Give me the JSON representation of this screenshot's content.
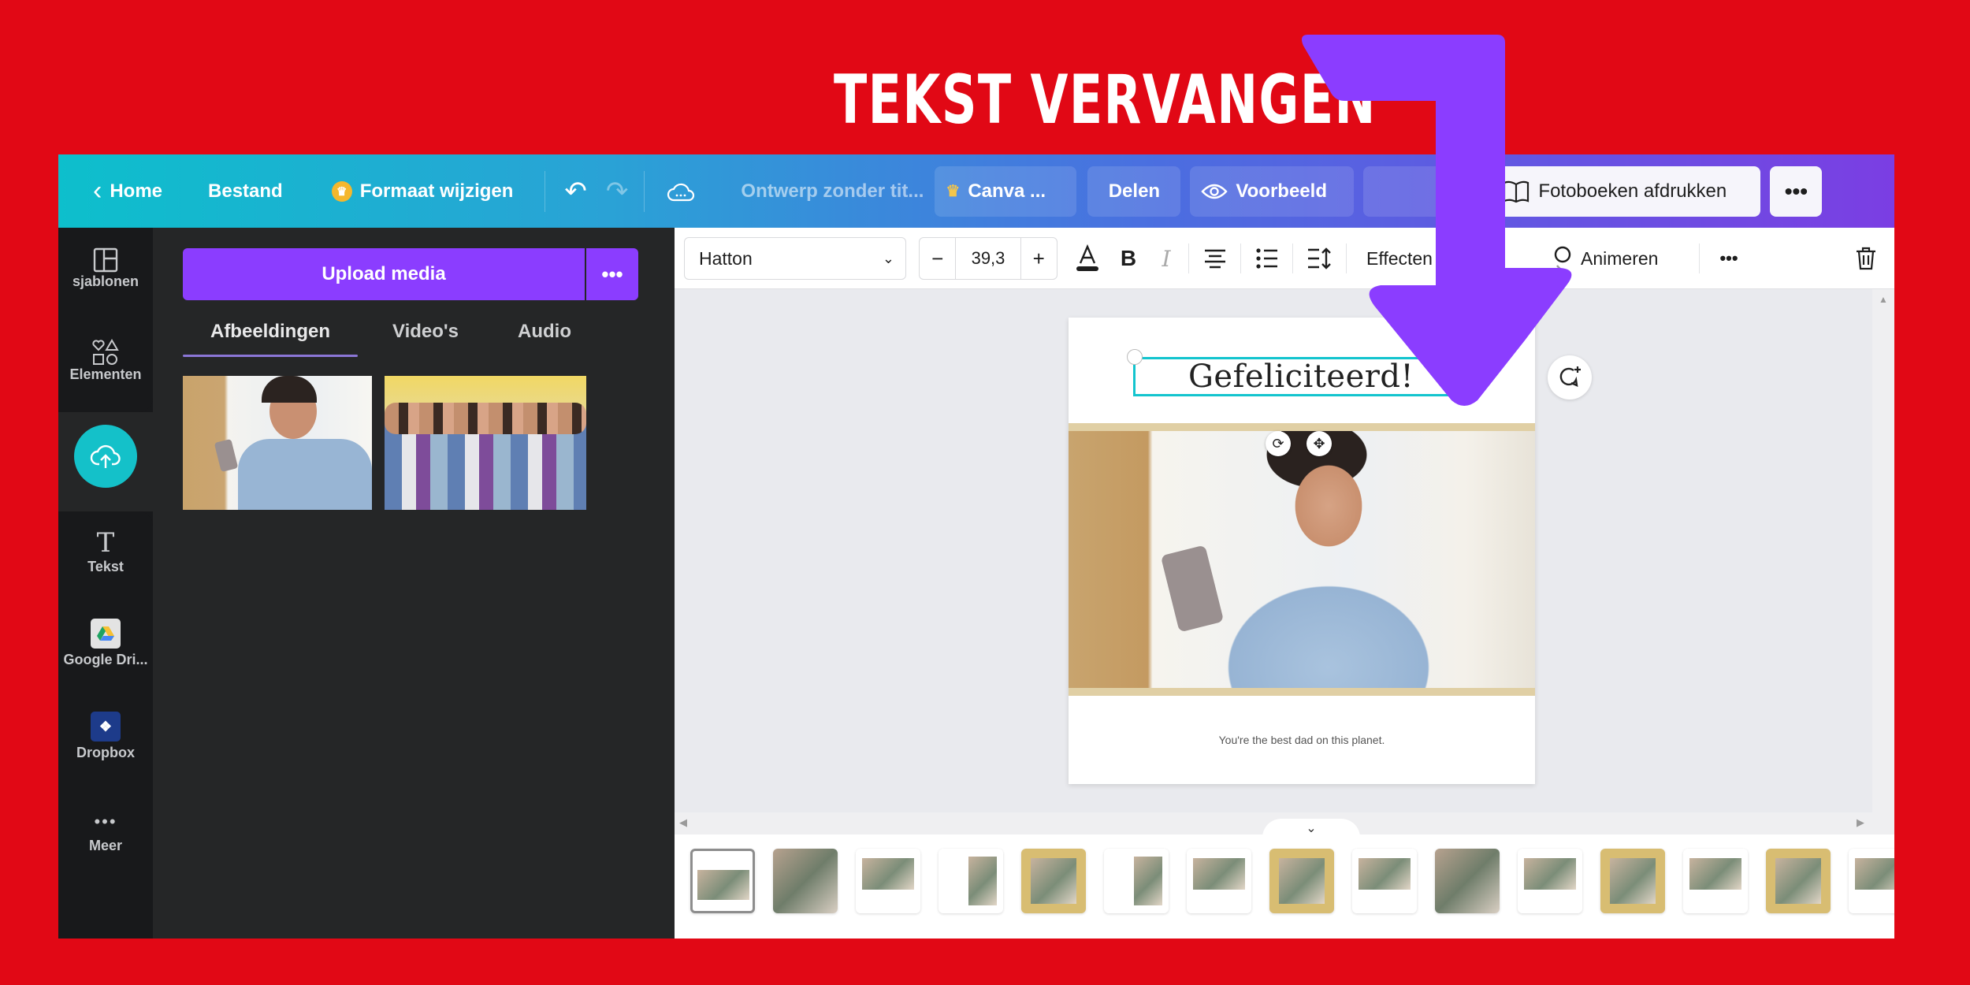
{
  "banner": {
    "title": "TEKST VERVANGEN"
  },
  "colors": {
    "background": "#e10815",
    "accent_purple": "#8b3dff",
    "teal": "#14c1c9",
    "arrow": "#8b3dff"
  },
  "topbar": {
    "home_label": "Home",
    "file_label": "Bestand",
    "resize_label": "Formaat wijzigen",
    "title_placeholder": "Ontwerp zonder tit...",
    "pro_label": "Canva ...",
    "share_label": "Delen",
    "preview_label": "Voorbeeld",
    "print_label": "Fotoboeken afdrukken",
    "more_label": "•••",
    "icons": {
      "back": "chevron-left-icon",
      "crown": "crown-icon",
      "undo": "undo-icon",
      "redo": "redo-icon",
      "cloud": "cloud-sync-icon",
      "eye": "eye-icon",
      "download": "download-icon",
      "book": "book-icon"
    }
  },
  "rail": {
    "items": [
      {
        "label": "sjablonen",
        "icon": "templates-icon"
      },
      {
        "label": "Elementen",
        "icon": "elements-icon"
      },
      {
        "label": "",
        "icon": "upload-cloud-icon"
      },
      {
        "label": "Tekst",
        "icon": "text-icon"
      },
      {
        "label": "Google Dri...",
        "icon": "google-drive-icon"
      },
      {
        "label": "Dropbox",
        "icon": "dropbox-icon"
      },
      {
        "label": "Meer",
        "icon": "more-icon"
      }
    ]
  },
  "panel": {
    "upload_label": "Upload media",
    "upload_more": "•••",
    "tabs": [
      {
        "label": "Afbeeldingen",
        "active": true
      },
      {
        "label": "Video's"
      },
      {
        "label": "Audio"
      }
    ],
    "images": [
      "man-with-phone",
      "group-of-teens"
    ]
  },
  "toolbar": {
    "font": "Hatton",
    "font_size": "39,3",
    "minus": "−",
    "plus": "+",
    "effects_label": "Effecten",
    "animate_label": "Animeren",
    "more_label": "•••"
  },
  "page": {
    "title": "Gefeliciteerd!",
    "subtitle": "You're the best dad on this planet."
  },
  "pages_strip": {
    "thumbs": [
      "white",
      "photo",
      "white",
      "white",
      "gold",
      "white",
      "white",
      "gold",
      "white",
      "photo",
      "white",
      "gold",
      "white",
      "gold",
      "white",
      "white"
    ],
    "active_index": 0
  }
}
